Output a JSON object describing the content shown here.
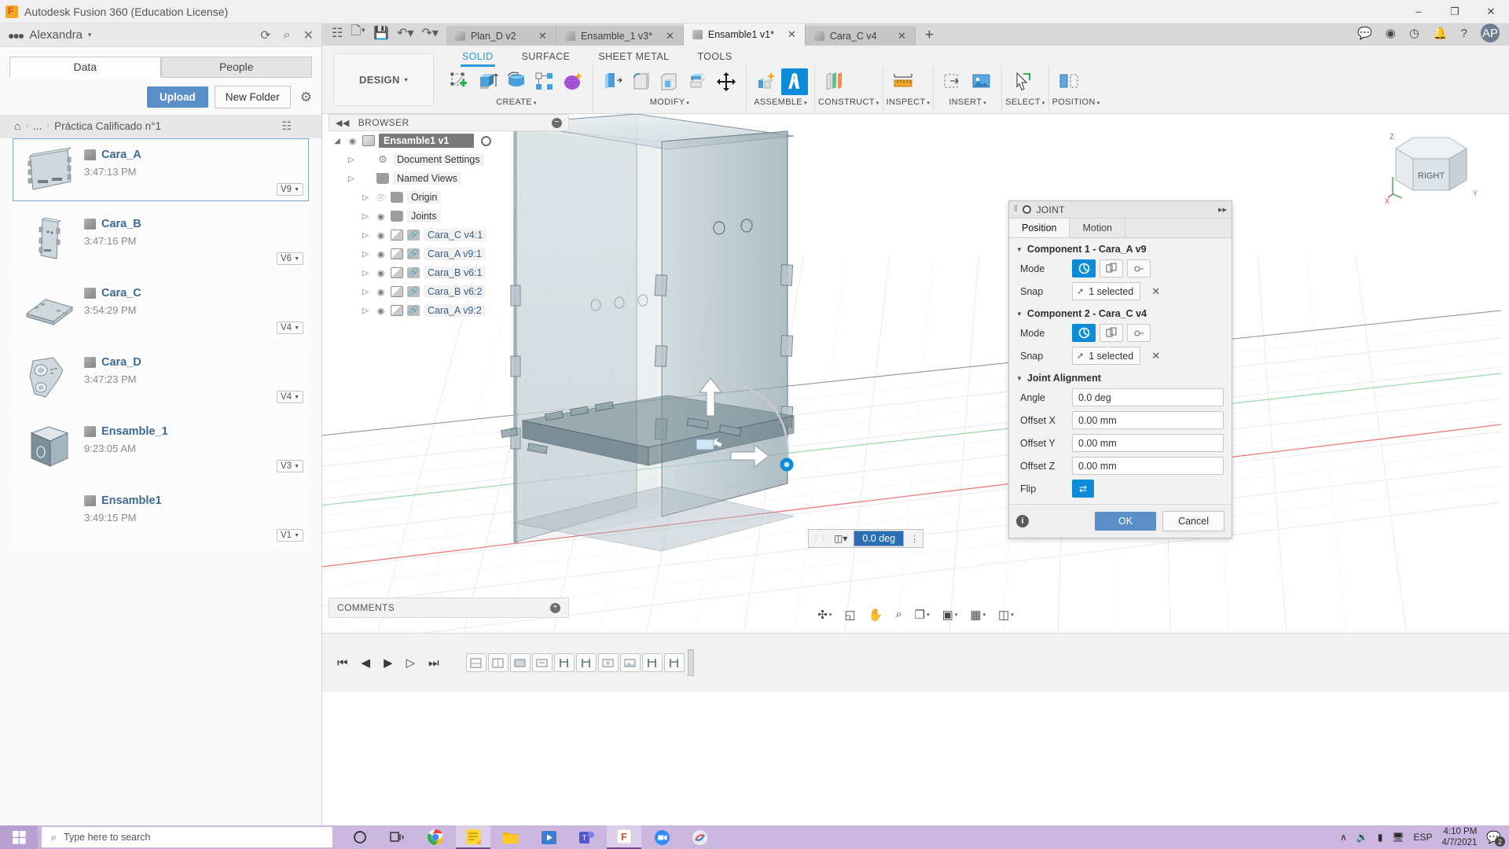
{
  "window": {
    "title": "Autodesk Fusion 360 (Education License)",
    "minimize": "–",
    "maximize": "❐",
    "close": "✕"
  },
  "data_panel": {
    "user": "Alexandra",
    "user_caret": "▾",
    "refresh_icon": "⟳",
    "search_icon": "⌕",
    "close_icon": "✕",
    "tabs": [
      {
        "label": "Data",
        "active": true
      },
      {
        "label": "People",
        "active": false
      }
    ],
    "upload_label": "Upload",
    "new_folder_label": "New Folder",
    "settings_icon": "⚙",
    "breadcrumb": {
      "home_icon": "⌂",
      "sep": "›",
      "ellipsis": "...",
      "current": "Práctica Calificado n°1",
      "globe_icon": "☷"
    },
    "files": [
      {
        "name": "Cara_A",
        "time": "3:47:13 PM",
        "version": "V9",
        "selected": true
      },
      {
        "name": "Cara_B",
        "time": "3:47:16 PM",
        "version": "V6",
        "selected": false
      },
      {
        "name": "Cara_C",
        "time": "3:54:29 PM",
        "version": "V4",
        "selected": false
      },
      {
        "name": "Cara_D",
        "time": "3:47:23 PM",
        "version": "V4",
        "selected": false
      },
      {
        "name": "Ensamble_1",
        "time": "9:23:05 AM",
        "version": "V3",
        "selected": false
      },
      {
        "name": "Ensamble1",
        "time": "3:49:15 PM",
        "version": "V1",
        "selected": false
      }
    ]
  },
  "quick_access": {
    "grid_icon": "☷",
    "file_icon": "὜b",
    "save_icon": "Ὃe",
    "undo_icon": "↶",
    "redo_icon": "↷"
  },
  "doc_tabs": [
    {
      "label": "Plan_D v2",
      "active": false
    },
    {
      "label": "Ensamble_1 v3*",
      "active": false
    },
    {
      "label": "Ensamble1 v1*",
      "active": true
    },
    {
      "label": "Cara_C v4",
      "active": false
    }
  ],
  "doc_tab_plus": "+",
  "topbar_right": {
    "comment_icon": "὞a",
    "globe_icon": "⊕",
    "clock_icon": "◴",
    "bell_icon": "ὑ4",
    "help_icon": "?",
    "avatar": "AP"
  },
  "ribbon": {
    "workspace": "DESIGN",
    "workspace_caret": "▾",
    "tabs": [
      {
        "label": "SOLID",
        "active": true
      },
      {
        "label": "SURFACE",
        "active": false
      },
      {
        "label": "SHEET METAL",
        "active": false
      },
      {
        "label": "TOOLS",
        "active": false
      }
    ],
    "groups": [
      {
        "label": "CREATE",
        "caret": "▾"
      },
      {
        "label": "MODIFY",
        "caret": "▾"
      },
      {
        "label": "ASSEMBLE",
        "caret": "▾"
      },
      {
        "label": "CONSTRUCT",
        "caret": "▾"
      },
      {
        "label": "INSPECT",
        "caret": "▾"
      },
      {
        "label": "INSERT",
        "caret": "▾"
      },
      {
        "label": "SELECT",
        "caret": "▾"
      },
      {
        "label": "POSITION",
        "caret": "▾"
      }
    ]
  },
  "browser": {
    "title": "BROWSER",
    "collapse_icon": "◀◀",
    "minus_icon": "−",
    "rows": [
      {
        "label": "Ensamble1 v1",
        "indent": 0,
        "twisty": "◢",
        "eye": "◉",
        "icon": "assy",
        "root": true
      },
      {
        "label": "Document Settings",
        "indent": 1,
        "twisty": "▷",
        "eye": "",
        "icon": "gear"
      },
      {
        "label": "Named Views",
        "indent": 1,
        "twisty": "▷",
        "eye": "",
        "icon": "folder"
      },
      {
        "label": "Origin",
        "indent": 2,
        "twisty": "▷",
        "eye": "off",
        "icon": "folder"
      },
      {
        "label": "Joints",
        "indent": 2,
        "twisty": "▷",
        "eye": "◉",
        "icon": "folder"
      },
      {
        "label": "Cara_C v4:1",
        "indent": 2,
        "twisty": "▷",
        "eye": "◉",
        "icon": "comp",
        "link": true
      },
      {
        "label": "Cara_A v9:1",
        "indent": 2,
        "twisty": "▷",
        "eye": "◉",
        "icon": "comp",
        "link": true
      },
      {
        "label": "Cara_B v6:1",
        "indent": 2,
        "twisty": "▷",
        "eye": "◉",
        "icon": "comp",
        "link": true
      },
      {
        "label": "Cara_B v6:2",
        "indent": 2,
        "twisty": "▷",
        "eye": "◉",
        "icon": "comp",
        "link": true
      },
      {
        "label": "Cara_A v9:2",
        "indent": 2,
        "twisty": "▷",
        "eye": "◉",
        "icon": "comp",
        "link": true
      }
    ]
  },
  "joint_dialog": {
    "title": "JOINT",
    "grip": "⫴",
    "expand_icon": "▸▸",
    "tabs": [
      {
        "label": "Position",
        "active": true
      },
      {
        "label": "Motion",
        "active": false
      }
    ],
    "component1": {
      "header": "Component 1 - Cara_A v9",
      "tri": "▼",
      "mode_label": "Mode",
      "snap_label": "Snap",
      "snap_value": "1 selected",
      "clear_icon": "✕"
    },
    "component2": {
      "header": "Component 2 - Cara_C v4",
      "tri": "▼",
      "mode_label": "Mode",
      "snap_label": "Snap",
      "snap_value": "1 selected",
      "clear_icon": "✕"
    },
    "alignment": {
      "header": "Joint Alignment",
      "tri": "▼",
      "fields": [
        {
          "label": "Angle",
          "value": "0.0 deg"
        },
        {
          "label": "Offset X",
          "value": "0.00 mm"
        },
        {
          "label": "Offset Y",
          "value": "0.00 mm"
        },
        {
          "label": "Offset Z",
          "value": "0.00 mm"
        }
      ],
      "flip_label": "Flip",
      "flip_icon": "⇄"
    },
    "info_icon": "i",
    "ok_label": "OK",
    "cancel_label": "Cancel"
  },
  "canvas": {
    "angle_input": {
      "value": "0.0 deg",
      "grip": "⋮⋮",
      "dots": "⋮"
    },
    "viewcube_face": "RIGHT",
    "axis_labels": {
      "x": "X",
      "y": "Y",
      "z": "Z"
    }
  },
  "comments_bar": {
    "label": "COMMENTS",
    "plus_icon": "+"
  },
  "navbar": [
    {
      "name": "orbit",
      "glyph": "✣",
      "caret": "▾"
    },
    {
      "name": "look-at",
      "glyph": "◱",
      "caret": ""
    },
    {
      "name": "pan",
      "glyph": "✋",
      "caret": ""
    },
    {
      "name": "zoom",
      "glyph": "⌕",
      "caret": ""
    },
    {
      "name": "fit",
      "glyph": "❐",
      "caret": "▾"
    },
    {
      "name": "display-settings",
      "glyph": "▣",
      "caret": "▾"
    },
    {
      "name": "grid-snaps",
      "glyph": "▦",
      "caret": "▾"
    },
    {
      "name": "viewports",
      "glyph": "◫",
      "caret": "▾"
    }
  ],
  "timeline": {
    "buttons": [
      "⏮",
      "◀",
      "▶",
      "▷",
      "⏭"
    ],
    "item_count": 10
  },
  "taskbar": {
    "start_icon": "⊞",
    "search_placeholder": "Type here to search",
    "search_icon": "⌕",
    "cortana_icon": "○",
    "taskview_icon": "⌸",
    "apps": [
      "chrome",
      "sticky-notes",
      "explorer",
      "media",
      "teams",
      "fusion360",
      "zoom",
      "app9"
    ],
    "tray": {
      "chevron": "∧",
      "volume_icon": "ὐa",
      "battery_icon": "▭",
      "network_icon": "὚7",
      "language": "ESP",
      "time": "4:10 PM",
      "date": "4/7/2021",
      "notif_icon": "὞a",
      "notif_count": "2"
    }
  }
}
